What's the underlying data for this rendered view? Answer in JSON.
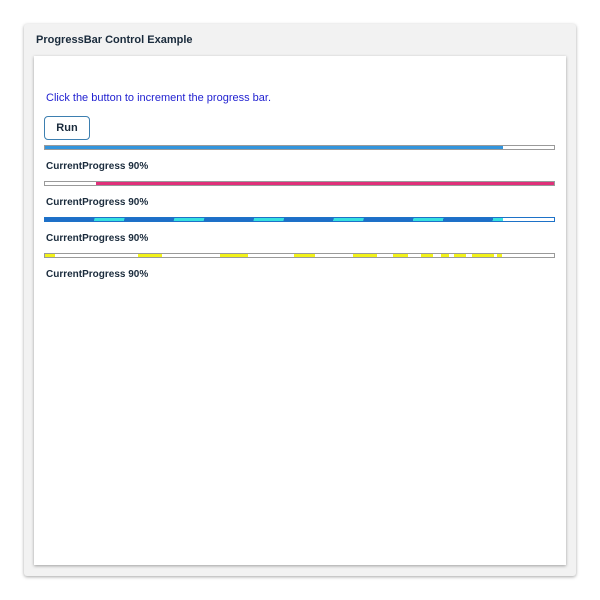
{
  "window": {
    "title": "ProgressBar Control Example"
  },
  "main": {
    "instruction": "Click the button to increment the progress bar.",
    "run_label": "Run"
  },
  "progress_bars": [
    {
      "fill_color": "#3395dd",
      "value": 0.9,
      "caption": "CurrentProgress 90%"
    },
    {
      "fill_color": "#e0307a",
      "value": 0.9,
      "caption": "CurrentProgress 90%"
    },
    {
      "fill_color": "#1e6fc8",
      "accent_color": "#37e0e0",
      "value": 0.9,
      "caption": "CurrentProgress 90%"
    },
    {
      "fill_color": "#f2f21a",
      "value": 0.9,
      "caption": "CurrentProgress 90%"
    }
  ]
}
